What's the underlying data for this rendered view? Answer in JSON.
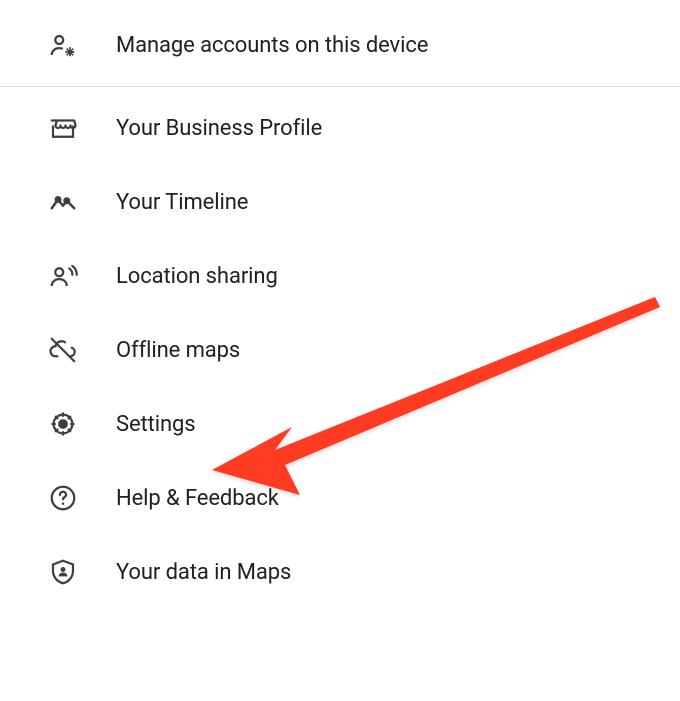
{
  "menu": {
    "items": [
      {
        "label": "Manage accounts on this device"
      },
      {
        "label": "Your Business Profile"
      },
      {
        "label": "Your Timeline"
      },
      {
        "label": "Location sharing"
      },
      {
        "label": "Offline maps"
      },
      {
        "label": "Settings"
      },
      {
        "label": "Help & Feedback"
      },
      {
        "label": "Your data in Maps"
      }
    ]
  },
  "annotation": {
    "arrow_color": "#ff3b20",
    "target": "Settings"
  }
}
